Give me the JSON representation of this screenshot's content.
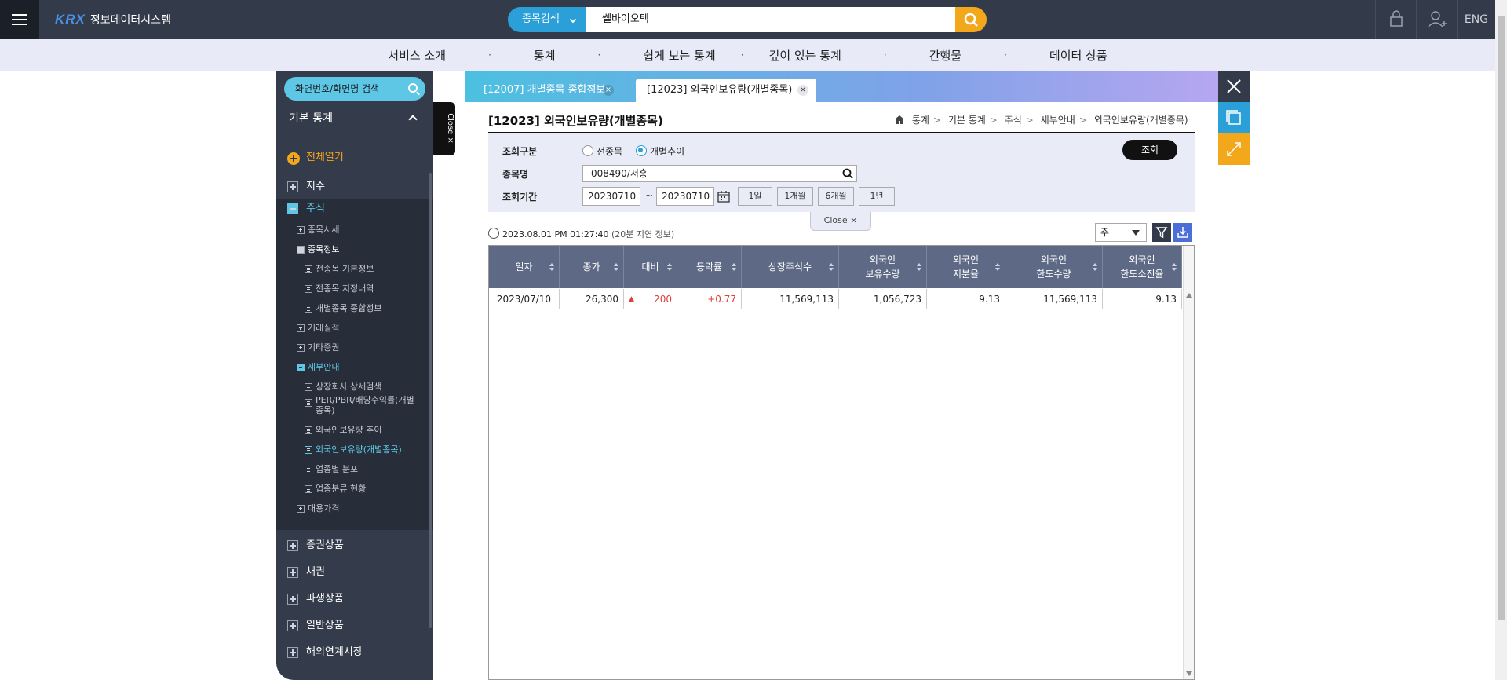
{
  "header": {
    "brand": "KRX",
    "system_name": "정보데이터시스템",
    "search_type": "종목검색",
    "search_value": "쎌바이오텍",
    "lang": "ENG"
  },
  "nav": [
    "서비스 소개",
    "통계",
    "쉽게 보는 통계",
    "깊이 있는 통계",
    "간행물",
    "데이터 상품"
  ],
  "nav_separator": "·",
  "sidebar": {
    "search_label": "화면번호/화면명 검색",
    "title": "기본 통계",
    "expand_all": "전체열기",
    "close_label": "Close ×",
    "top_items": [
      "지수",
      "주식"
    ],
    "sub_items": [
      {
        "label": "종목시세",
        "icon": "plus"
      },
      {
        "label": "종목정보",
        "icon": "minus"
      },
      {
        "label": "전종목 기본정보",
        "icon": "doc"
      },
      {
        "label": "전종목 지정내역",
        "icon": "doc"
      },
      {
        "label": "개별종목 종합정보",
        "icon": "doc"
      },
      {
        "label": "거래실적",
        "icon": "plus"
      },
      {
        "label": "기타증권",
        "icon": "plus"
      },
      {
        "label": "세부안내",
        "icon": "minus"
      },
      {
        "label": "상장회사 상세검색",
        "icon": "doc"
      },
      {
        "label": "PER/PBR/배당수익률(개별",
        "label2": "종목)",
        "icon": "doc"
      },
      {
        "label": "외국인보유량 추이",
        "icon": "doc"
      },
      {
        "label": "외국인보유량(개별종목)",
        "icon": "doc"
      },
      {
        "label": "업종별 분포",
        "icon": "doc"
      },
      {
        "label": "업종분류 현황",
        "icon": "doc"
      },
      {
        "label": "대용가격",
        "icon": "plus"
      }
    ],
    "bottom_items": [
      "증권상품",
      "채권",
      "파생상품",
      "일반상품",
      "해외연계시장"
    ]
  },
  "tabs": [
    {
      "label": "[12007] 개별종목 종합정보",
      "close": "×"
    },
    {
      "label": "[12023] 외국인보유량(개별종목)",
      "close": "×"
    }
  ],
  "page": {
    "title": "[12023] 외국인보유량(개별종목)",
    "breadcrumb": [
      "통계",
      "기본 통계",
      "주식",
      "세부안내",
      "외국인보유량(개별종목)"
    ],
    "breadcrumb_sep": ">"
  },
  "filter": {
    "type_label": "조회구분",
    "type_options": [
      "전종목",
      "개별추이"
    ],
    "type_selected": "개별추이",
    "stock_label": "종목명",
    "stock_value": "008490/서흥",
    "period_label": "조회기간",
    "date_from": "20230710",
    "date_sep": "~",
    "date_to": "20230710",
    "period_buttons": [
      "1일",
      "1개월",
      "6개월",
      "1년"
    ],
    "search_button": "조회",
    "close_label": "Close ×"
  },
  "timestamp": "2023.08.01 PM 01:27:40",
  "timestamp_note": "(20분 지연 정보)",
  "unit_select": "주",
  "table": {
    "columns": [
      {
        "l1": "일자",
        "l2": ""
      },
      {
        "l1": "종가",
        "l2": ""
      },
      {
        "l1": "대비",
        "l2": ""
      },
      {
        "l1": "등락률",
        "l2": ""
      },
      {
        "l1": "상장주식수",
        "l2": ""
      },
      {
        "l1": "외국인",
        "l2": "보유수량"
      },
      {
        "l1": "외국인",
        "l2": "지분율"
      },
      {
        "l1": "외국인",
        "l2": "한도수량"
      },
      {
        "l1": "외국인",
        "l2": "한도소진율"
      }
    ],
    "rows": [
      [
        "2023/07/10",
        "26,300",
        "200",
        "+0.77",
        "11,569,113",
        "1,056,723",
        "9.13",
        "11,569,113",
        "9.13"
      ]
    ],
    "change_up_symbol": "▲"
  },
  "colors": {
    "header_bg": "#333a49",
    "accent_blue": "#2a9fd8",
    "accent_orange": "#f3a71b",
    "up_red": "#e0403a"
  }
}
